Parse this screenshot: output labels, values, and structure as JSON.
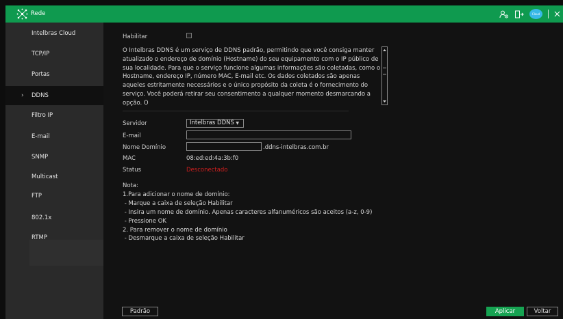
{
  "header": {
    "title": "Rede",
    "cloud_badge": "Cloud",
    "accent": "#0f9a4f"
  },
  "sidebar": {
    "items": [
      {
        "label": "Intelbras Cloud"
      },
      {
        "label": "TCP/IP"
      },
      {
        "label": "Portas"
      },
      {
        "label": "DDNS",
        "active": true
      },
      {
        "label": "Filtro IP"
      },
      {
        "label": "E-mail"
      },
      {
        "label": "SNMP"
      },
      {
        "label": "Multicast"
      },
      {
        "label": "FTP"
      },
      {
        "label": "802.1x"
      },
      {
        "label": "RTMP"
      }
    ],
    "chevron": "›"
  },
  "form": {
    "enable_label": "Habilitar",
    "enable_checked": false,
    "description": "O Intelbras DDNS é um serviço de DDNS padrão, permitindo que você consiga manter atualizado o endereço de domínio (Hostname) do seu equipamento com o IP público de sua localidade. Para que o serviço funcione algumas informações são coletadas, como o Hostname, endereço IP, número MAC, E-mail etc. Os dados coletados são apenas aqueles estritamente necessários e o único propósito da coleta é o fornecimento do serviço. Você poderá retirar seu consentimento a qualquer momento desmarcando a opção. O",
    "server_label": "Servidor",
    "server_value": "Intelbras DDNS",
    "email_label": "E-mail",
    "email_value": "",
    "domain_label": "Nome Domínio",
    "domain_value": "",
    "domain_suffix": ".ddns-intelbras.com.br",
    "mac_label": "MAC",
    "mac_value": "08:ed:ed:4a:3b:f0",
    "status_label": "Status",
    "status_value": "Desconectado",
    "status_color": "#d11f1f"
  },
  "notes": {
    "lines": [
      "Nota:",
      "1.Para adicionar o nome de domínio:",
      " - Marque a caixa de seleção Habilitar",
      " - Insira um nome de domínio. Apenas caracteres alfanuméricos são aceitos (a-z, 0-9)",
      " - Pressione OK",
      "2. Para remover o nome de domínio",
      " - Desmarque a caixa de seleção Habilitar"
    ]
  },
  "buttons": {
    "default_label": "Padrão",
    "apply_label": "Aplicar",
    "back_label": "Voltar"
  }
}
